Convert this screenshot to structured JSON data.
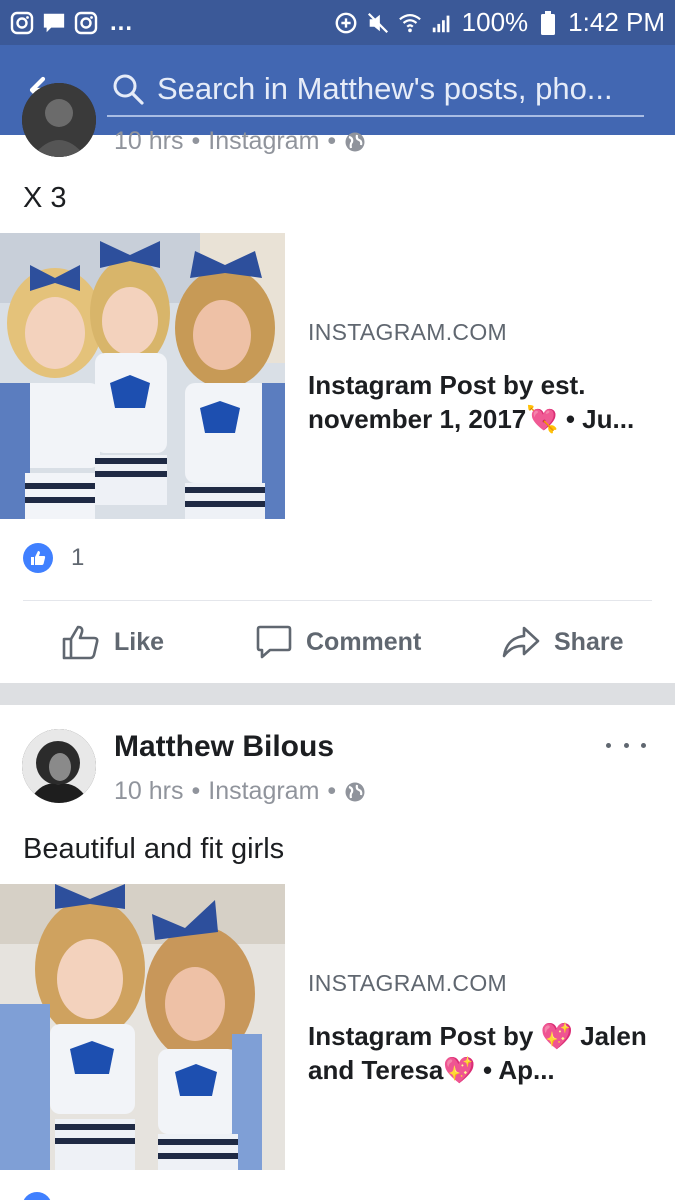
{
  "status_bar": {
    "icons_left": [
      "camera-icon",
      "chat-icon",
      "instagram-icon"
    ],
    "overflow": "...",
    "battery": "100%",
    "time": "1:42 PM"
  },
  "header": {
    "back": "arrow-left-icon",
    "search_placeholder": "Search in Matthew's posts, pho..."
  },
  "posts": [
    {
      "meta_time": "10 hrs",
      "meta_source": "Instagram",
      "text": "X 3",
      "link": {
        "domain": "INSTAGRAM.COM",
        "title": "Instagram Post by est. november 1, 2017💘 • Ju..."
      },
      "like_count": "1",
      "actions": {
        "like": "Like",
        "comment": "Comment",
        "share": "Share"
      }
    },
    {
      "author": "Matthew Bilous",
      "meta_time": "10 hrs",
      "meta_source": "Instagram",
      "text": "Beautiful and fit girls",
      "link": {
        "domain": "INSTAGRAM.COM",
        "title": "Instagram Post by 💖 Jalen and Teresa💖 • Ap..."
      }
    }
  ],
  "colors": {
    "status_bar": "#3b5998",
    "header": "#4267b2",
    "like_blue": "#4080ff",
    "meta_gray": "#90949c"
  }
}
